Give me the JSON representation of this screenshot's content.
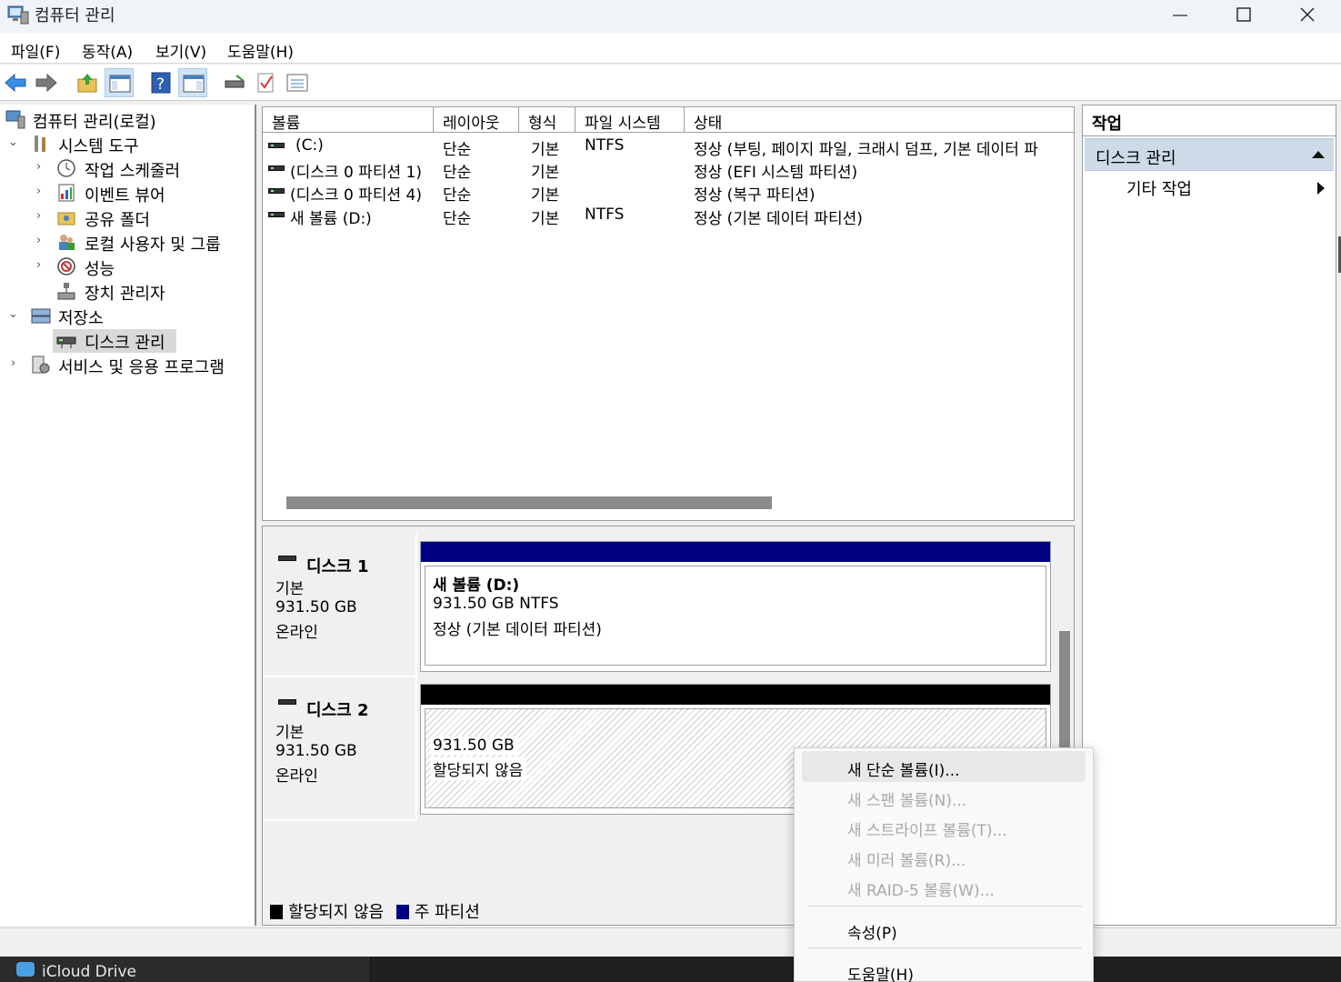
{
  "window": {
    "title": "컴퓨터 관리"
  },
  "menu": [
    "파일(F)",
    "동작(A)",
    "보기(V)",
    "도움말(H)"
  ],
  "tree": {
    "root": "컴퓨터 관리(로컬)",
    "system_tools": "시스템 도구",
    "task_scheduler": "작업 스케줄러",
    "event_viewer": "이벤트 뷰어",
    "shared_folders": "공유 폴더",
    "local_users": "로컬 사용자 및 그룹",
    "performance": "성능",
    "device_manager": "장치 관리자",
    "storage": "저장소",
    "disk_management": "디스크 관리",
    "services": "서비스 및 응용 프로그램"
  },
  "volume_table": {
    "columns": [
      "볼륨",
      "레이아웃",
      "형식",
      "파일 시스템",
      "상태"
    ],
    "rows": [
      {
        "volume": "(C:)",
        "layout": "단순",
        "type": "기본",
        "fs": "NTFS",
        "status": "정상 (부팅, 페이지 파일, 크래시 덤프, 기본 데이터 파"
      },
      {
        "volume": "(디스크 0 파티션 1)",
        "layout": "단순",
        "type": "기본",
        "fs": "",
        "status": "정상 (EFI 시스템 파티션)"
      },
      {
        "volume": "(디스크 0 파티션 4)",
        "layout": "단순",
        "type": "기본",
        "fs": "",
        "status": "정상 (복구 파티션)"
      },
      {
        "volume": "새 볼륨 (D:)",
        "layout": "단순",
        "type": "기본",
        "fs": "NTFS",
        "status": "정상 (기본 데이터 파티션)"
      }
    ]
  },
  "disks": [
    {
      "name": "디스크 1",
      "type": "기본",
      "size": "931.50 GB",
      "state": "온라인",
      "partition": {
        "title": "새 볼륨  (D:)",
        "line1": "931.50 GB NTFS",
        "line2": "정상 (기본 데이터 파티션)",
        "bar_color": "#000080"
      }
    },
    {
      "name": "디스크 2",
      "type": "기본",
      "size": "931.50 GB",
      "state": "온라인",
      "partition": {
        "line1": "931.50 GB",
        "line2": "할당되지 않음",
        "bar_color": "#000000"
      }
    }
  ],
  "legend": {
    "unallocated": "할당되지 않음",
    "primary": "주 파티션",
    "unallocated_color": "#000000",
    "primary_color": "#000080"
  },
  "actions": {
    "header": "작업",
    "section": "디스크 관리",
    "more": "기타 작업"
  },
  "context_menu": {
    "new_simple": "새 단순 볼륨(I)...",
    "new_spanned": "새 스팬 볼륨(N)...",
    "new_striped": "새 스트라이프 볼륨(T)...",
    "new_mirror": "새 미러 볼륨(R)...",
    "new_raid5": "새 RAID-5 볼륨(W)...",
    "properties": "속성(P)",
    "help": "도움말(H)"
  },
  "taskbar": {
    "item": "iCloud Drive"
  }
}
